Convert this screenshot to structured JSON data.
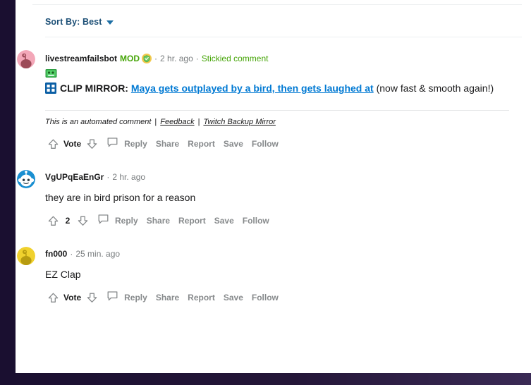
{
  "theme": {
    "link_blue": "#0079d3",
    "mod_green": "#46a508",
    "muted_gray": "#878a8c",
    "text_dark": "#1a1a1b",
    "page_border": "#2a1a45"
  },
  "sort": {
    "label": "Sort By: Best",
    "caret_icon": "chevron-down-icon"
  },
  "actions_labels": {
    "vote": "Vote",
    "reply": "Reply",
    "share": "Share",
    "report": "Report",
    "save": "Save",
    "follow": "Follow"
  },
  "comments": [
    {
      "id": "comment-1",
      "username": "livestreamfailsbot",
      "mod_tag": "MOD",
      "badge_icon": "mod-shield-icon",
      "timestamp": "2 hr. ago",
      "stickied_label": "Stickied comment",
      "has_flair_emoji": true,
      "flair_icon": "green-flair-emoji",
      "avatar_style": "pink-snoo",
      "body": {
        "icon": "clip-film-icon",
        "prefix": "CLIP MIRROR:",
        "link_text": "Maya gets outplayed by a bird, then gets laughed at",
        "suffix": "(now fast & smooth again!)"
      },
      "footnote": {
        "text": "This is an automated comment",
        "links": [
          "Feedback",
          "Twitch Backup Mirror"
        ],
        "separator": "|"
      },
      "score": "Vote",
      "score_is_word": true
    },
    {
      "id": "comment-2",
      "username": "VgUPqEaEnGr",
      "timestamp": "2 hr. ago",
      "avatar_style": "blue-snoo",
      "body": {
        "text": "they are in bird prison for a reason"
      },
      "score": "2",
      "score_is_word": false
    },
    {
      "id": "comment-3",
      "username": "fn000",
      "timestamp": "25 min. ago",
      "avatar_style": "gold-snoo",
      "body": {
        "text": "EZ Clap"
      },
      "score": "Vote",
      "score_is_word": true
    }
  ]
}
